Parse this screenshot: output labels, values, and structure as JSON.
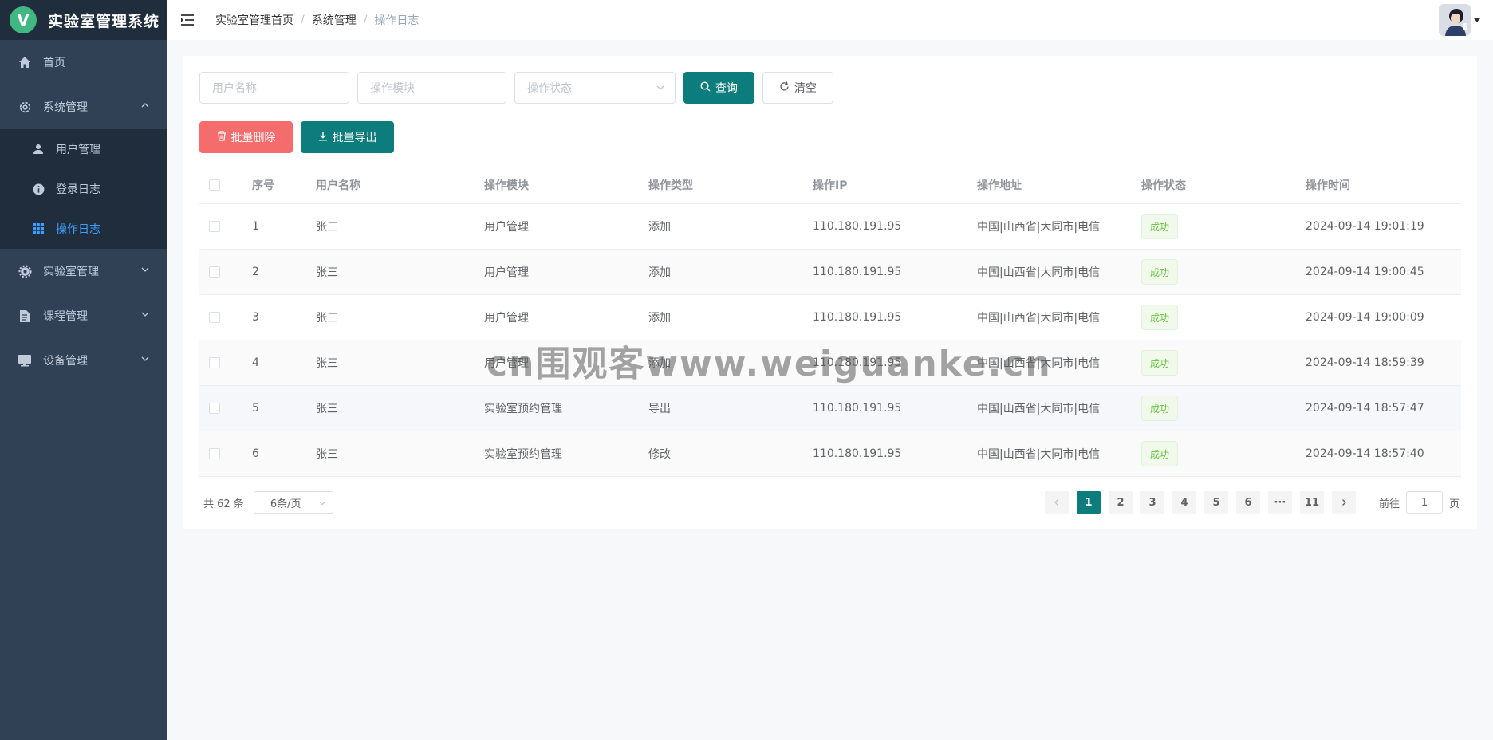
{
  "app": {
    "title": "实验室管理系统",
    "logo_letter": "V"
  },
  "sidebar": {
    "items": [
      {
        "label": "首页",
        "icon": "home-icon"
      },
      {
        "label": "系统管理",
        "icon": "gear-icon",
        "expanded": true,
        "children": [
          {
            "label": "用户管理",
            "icon": "user-icon"
          },
          {
            "label": "登录日志",
            "icon": "info-icon"
          },
          {
            "label": "操作日志",
            "icon": "grid-icon",
            "active": true
          }
        ]
      },
      {
        "label": "实验室管理",
        "icon": "cog-icon"
      },
      {
        "label": "课程管理",
        "icon": "document-icon"
      },
      {
        "label": "设备管理",
        "icon": "monitor-icon"
      }
    ]
  },
  "breadcrumb": [
    "实验室管理首页",
    "系统管理",
    "操作日志"
  ],
  "filters": {
    "username_placeholder": "用户名称",
    "module_placeholder": "操作模块",
    "status_placeholder": "操作状态",
    "search_label": "查询",
    "clear_label": "清空"
  },
  "actions": {
    "batch_delete": "批量删除",
    "batch_export": "批量导出"
  },
  "table": {
    "columns": [
      "序号",
      "用户名称",
      "操作模块",
      "操作类型",
      "操作IP",
      "操作地址",
      "操作状态",
      "操作时间"
    ],
    "rows": [
      [
        "1",
        "张三",
        "用户管理",
        "添加",
        "110.180.191.95",
        "中国|山西省|大同市|电信",
        "成功",
        "2024-09-14 19:01:19"
      ],
      [
        "2",
        "张三",
        "用户管理",
        "添加",
        "110.180.191.95",
        "中国|山西省|大同市|电信",
        "成功",
        "2024-09-14 19:00:45"
      ],
      [
        "3",
        "张三",
        "用户管理",
        "添加",
        "110.180.191.95",
        "中国|山西省|大同市|电信",
        "成功",
        "2024-09-14 19:00:09"
      ],
      [
        "4",
        "张三",
        "用户管理",
        "添加",
        "110.180.191.95",
        "中国|山西省|大同市|电信",
        "成功",
        "2024-09-14 18:59:39"
      ],
      [
        "5",
        "张三",
        "实验室预约管理",
        "导出",
        "110.180.191.95",
        "中国|山西省|大同市|电信",
        "成功",
        "2024-09-14 18:57:47"
      ],
      [
        "6",
        "张三",
        "实验室预约管理",
        "修改",
        "110.180.191.95",
        "中国|山西省|大同市|电信",
        "成功",
        "2024-09-14 18:57:40"
      ]
    ]
  },
  "pagination": {
    "total_text": "共 62 条",
    "page_size": "6条/页",
    "pages": [
      "1",
      "2",
      "3",
      "4",
      "5",
      "6",
      "···",
      "11"
    ],
    "current": "1",
    "goto_prefix": "前往",
    "goto_value": "1",
    "goto_suffix": "页"
  },
  "watermark": "cn围观客www.weiguanke.cn",
  "colors": {
    "sidebar_bg": "#304156",
    "primary": "#0d7c7c",
    "danger": "#f56c6c",
    "active_menu": "#409eff",
    "success": "#67c23a"
  }
}
